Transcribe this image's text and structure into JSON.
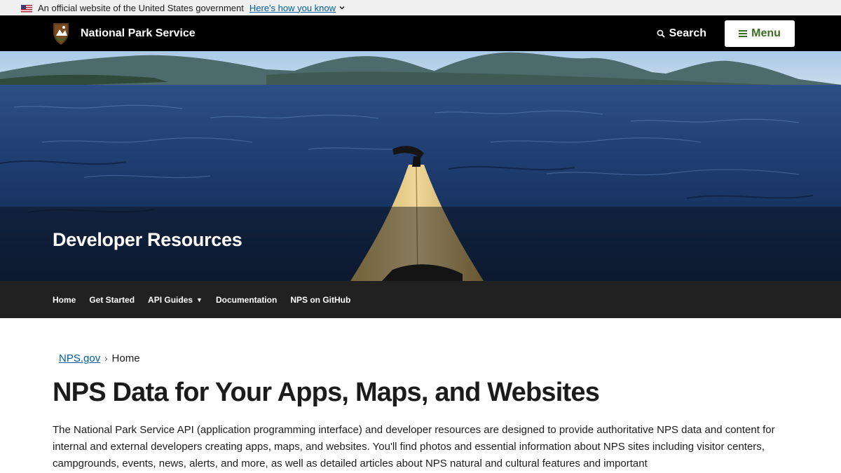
{
  "gov_banner": {
    "text": "An official website of the United States government",
    "link_label": "Here's how you know"
  },
  "header": {
    "site_name": "National Park Service",
    "search_label": "Search",
    "menu_label": "Menu",
    "logo_icon": "nps-arrowhead-icon"
  },
  "hero": {
    "title": "Developer Resources"
  },
  "subnav": {
    "items": [
      {
        "label": "Home"
      },
      {
        "label": "Get Started"
      },
      {
        "label": "API Guides",
        "has_dropdown": true
      },
      {
        "label": "Documentation"
      },
      {
        "label": "NPS on GitHub"
      }
    ]
  },
  "breadcrumb": {
    "link": "NPS.gov",
    "separator": "›",
    "current": "Home"
  },
  "main": {
    "title": "NPS Data for Your Apps, Maps, and Websites",
    "intro": "The National Park Service API (application programming interface) and developer resources are designed to provide authoritative NPS data and content for internal and external developers creating apps, maps, and websites. You'll find photos and essential information about NPS sites including visitor centers, campgrounds, events, news, alerts, and more, as well as detailed articles about NPS natural and cultural features and important"
  },
  "colors": {
    "link": "#005ea2",
    "menu_text": "#3b6e22",
    "header_bg": "#000000",
    "subnav_bg": "#212121"
  }
}
